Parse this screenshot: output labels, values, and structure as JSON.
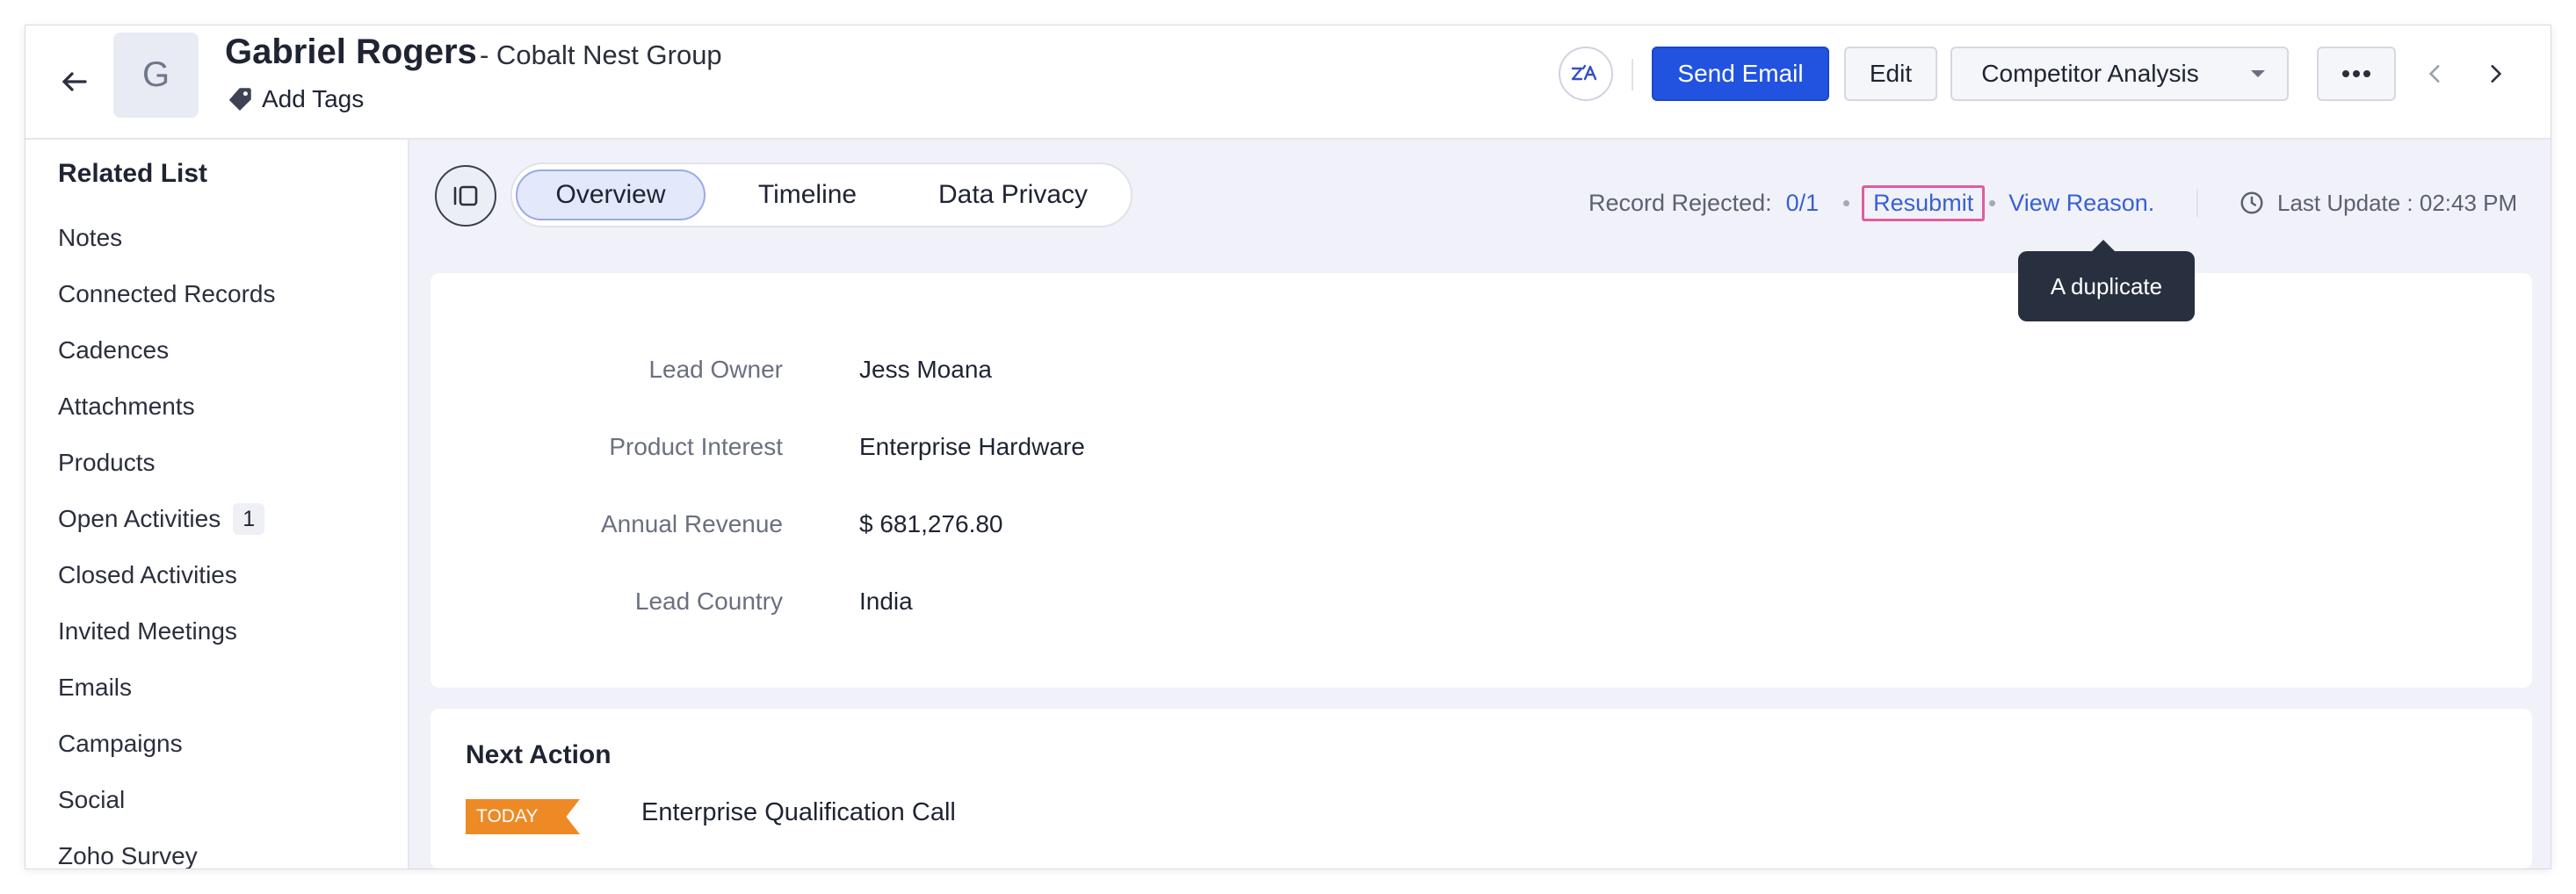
{
  "record": {
    "avatar_letter": "G",
    "name": "Gabriel Rogers",
    "company": "- Cobalt Nest Group",
    "add_tags": "Add Tags"
  },
  "toolbar": {
    "zia_icon": "zia-icon",
    "send_email": "Send Email",
    "edit": "Edit",
    "competitor_analysis": "Competitor Analysis"
  },
  "sidebar": {
    "title": "Related List",
    "items": [
      {
        "label": "Notes"
      },
      {
        "label": "Connected Records"
      },
      {
        "label": "Cadences"
      },
      {
        "label": "Attachments"
      },
      {
        "label": "Products"
      },
      {
        "label": "Open Activities",
        "count": "1"
      },
      {
        "label": "Closed Activities"
      },
      {
        "label": "Invited Meetings"
      },
      {
        "label": "Emails"
      },
      {
        "label": "Campaigns"
      },
      {
        "label": "Social"
      },
      {
        "label": "Zoho Survey"
      }
    ]
  },
  "tabs": [
    {
      "label": "Overview",
      "active": true
    },
    {
      "label": "Timeline",
      "active": false
    },
    {
      "label": "Data Privacy",
      "active": false
    }
  ],
  "status": {
    "record_rejected_label": "Record Rejected:",
    "record_rejected_value": "0/1",
    "resubmit": "Resubmit",
    "view_reason": "View Reason.",
    "last_update": "Last Update : 02:43 PM",
    "tooltip": "A duplicate"
  },
  "overview": {
    "fields": [
      {
        "label": "Lead Owner",
        "value": "Jess Moana"
      },
      {
        "label": "Product Interest",
        "value": "Enterprise Hardware"
      },
      {
        "label": "Annual Revenue",
        "value": "$ 681,276.80"
      },
      {
        "label": "Lead Country",
        "value": "India"
      }
    ]
  },
  "next_action": {
    "title": "Next Action",
    "tag": "TODAY",
    "name": "Enterprise Qualification Call"
  },
  "colors": {
    "primary": "#2153e0",
    "link": "#3860d6",
    "today_tag": "#ee8a26",
    "highlight_border": "#e05ca0"
  }
}
